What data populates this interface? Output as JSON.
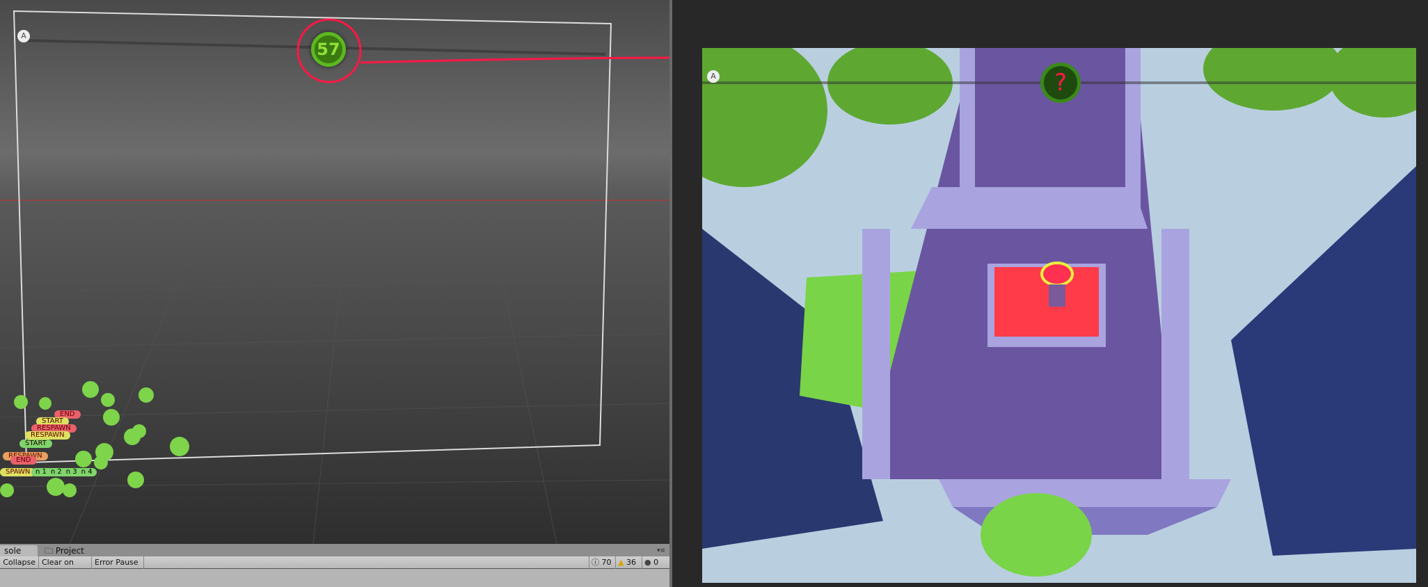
{
  "scene": {
    "gizmo_label": "A",
    "timer_value": "57",
    "markers": [
      "END",
      "START",
      "RESPAWN",
      "END",
      "RESPAWN",
      "END",
      "RESPAWN",
      "START",
      "RESPAWN",
      "END",
      "SPAWN"
    ],
    "spawn_points": [
      "n 1",
      "n 2",
      "n 3",
      "n 4"
    ]
  },
  "console": {
    "tabs": [
      "sole",
      "Project"
    ],
    "toolbar": {
      "collapse": "Collapse",
      "clear_on_play": "Clear on Play",
      "error_pause": "Error Pause"
    },
    "counts": {
      "info": "70",
      "warning": "36",
      "error": "0"
    }
  },
  "game": {
    "gizmo_label": "A",
    "timer_value": "?"
  },
  "colors": {
    "annotation": "#ff1744",
    "timer_green": "#4caf1a",
    "platform": "#ff3b4a",
    "road": "#6a55a0"
  }
}
